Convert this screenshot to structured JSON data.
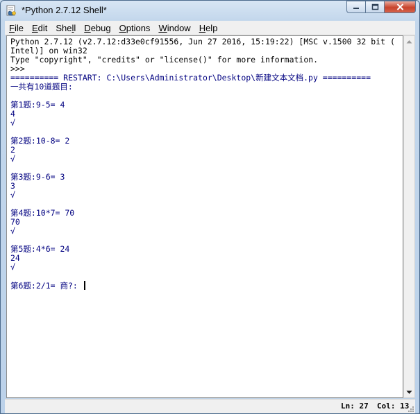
{
  "window": {
    "title": "*Python 2.7.12 Shell*"
  },
  "menu": [
    {
      "pre": "",
      "key": "F",
      "post": "ile"
    },
    {
      "pre": "",
      "key": "E",
      "post": "dit"
    },
    {
      "pre": "She",
      "key": "l",
      "post": "l"
    },
    {
      "pre": "",
      "key": "D",
      "post": "ebug"
    },
    {
      "pre": "",
      "key": "O",
      "post": "ptions"
    },
    {
      "pre": "",
      "key": "W",
      "post": "indow"
    },
    {
      "pre": "",
      "key": "H",
      "post": "elp"
    }
  ],
  "shell": {
    "banner1": "Python 2.7.12 (v2.7.12:d33e0cf91556, Jun 27 2016, 15:19:22) [MSC v.1500 32 bit (",
    "banner2": "Intel)] on win32",
    "banner3": "Type \"copyright\", \"credits\" or \"license()\" for more information.",
    "prompt": ">>> ",
    "restart": "========== RESTART: C:\\Users\\Administrator\\Desktop\\新建文本文档.py ==========",
    "header": "一共有10道题目:",
    "q1": "第1题:9-5= 4",
    "a1": "4",
    "m1": "√",
    "q2": "第2题:10-8= 2",
    "a2": "2",
    "m2": "√",
    "q3": "第3题:9-6= 3",
    "a3": "3",
    "m3": "√",
    "q4": "第4题:10*7= 70",
    "a4": "70",
    "m4": "√",
    "q5": "第5题:4*6= 24",
    "a5": "24",
    "m5": "√",
    "q6": "第6题:2/1= 商?: "
  },
  "status": {
    "line": "Ln: 27",
    "col": "Col: 13"
  },
  "icons": {
    "app": "python-idle-icon",
    "minimize": "minimize-icon",
    "maximize": "maximize-icon",
    "close": "close-icon"
  },
  "colors": {
    "output": "#000000",
    "stdout": "#000080",
    "stdin": "#0000ff"
  }
}
